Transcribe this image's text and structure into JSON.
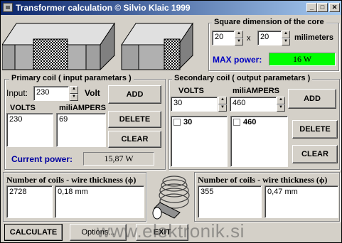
{
  "window": {
    "title": "Transformer calculation © Silvio Klaic 1999"
  },
  "core": {
    "group_label": "Square dimension of the core",
    "dim_a": "20",
    "x_label": "x",
    "dim_b": "20",
    "unit": "milimeters",
    "max_power_label": "MAX power:",
    "max_power_value": "16 W"
  },
  "primary": {
    "group_label": "Primary coil ( input parametars )",
    "input_label": "Input:",
    "input_value": "230",
    "input_unit": "Volt",
    "volts_header": "VOLTS",
    "amps_header": "miliAMPERS",
    "volts_list": [
      "230"
    ],
    "amps_list": [
      "69"
    ],
    "add": "ADD",
    "delete": "DELETE",
    "clear": "CLEAR",
    "current_power_label": "Current power:",
    "current_power_value": "15,87 W"
  },
  "secondary": {
    "group_label": "Secondary coil ( output parametars )",
    "volts_header": "VOLTS",
    "amps_header": "miliAMPERS",
    "volts_value": "30",
    "amps_value": "460",
    "volts_list": [
      "30"
    ],
    "amps_list": [
      "460"
    ],
    "add": "ADD",
    "delete": "DELETE",
    "clear": "CLEAR"
  },
  "coils_left": {
    "label": "Number of coils - wire thickness (ϕ)",
    "coils": "2728",
    "thickness": "0,18 mm"
  },
  "coils_right": {
    "label": "Number of coils - wire thickness (ϕ)",
    "coils": "355",
    "thickness": "0,47 mm"
  },
  "buttons": {
    "calculate": "CALCULATE",
    "options": "Options...",
    "exit": "EXIT"
  },
  "watermark": "www.elektronik.si"
}
